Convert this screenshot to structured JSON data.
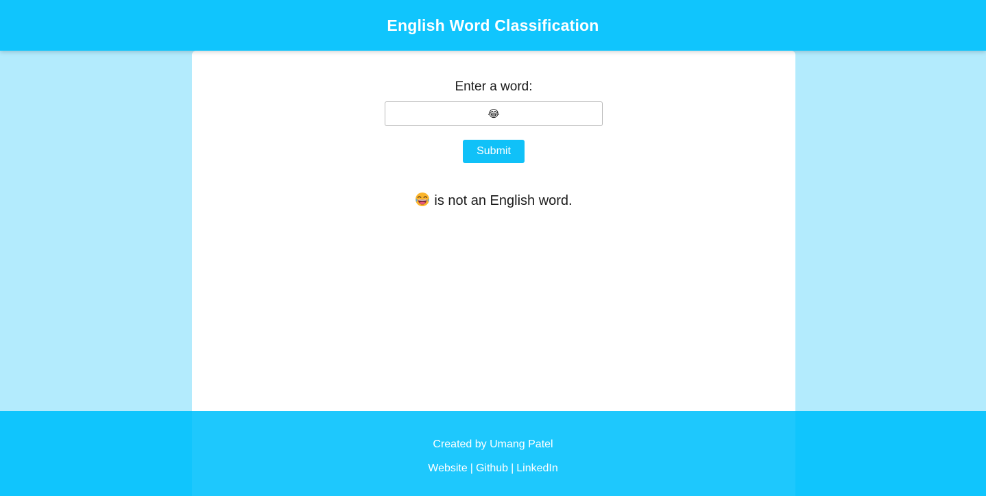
{
  "header": {
    "title": "English Word Classification"
  },
  "form": {
    "label": "Enter a word:",
    "input_value": "😂",
    "submit_label": "Submit"
  },
  "result": {
    "word": "😂",
    "message": "is not an English word."
  },
  "footer": {
    "credit": "Created by Umang Patel",
    "links": [
      "Website",
      "Github",
      "LinkedIn"
    ],
    "separator": "|"
  },
  "colors": {
    "header_bg": "#10c5fd",
    "page_bg": "#b3ebfd",
    "button_bg": "#10c1f8",
    "footer_bg": "#10c5fd"
  }
}
